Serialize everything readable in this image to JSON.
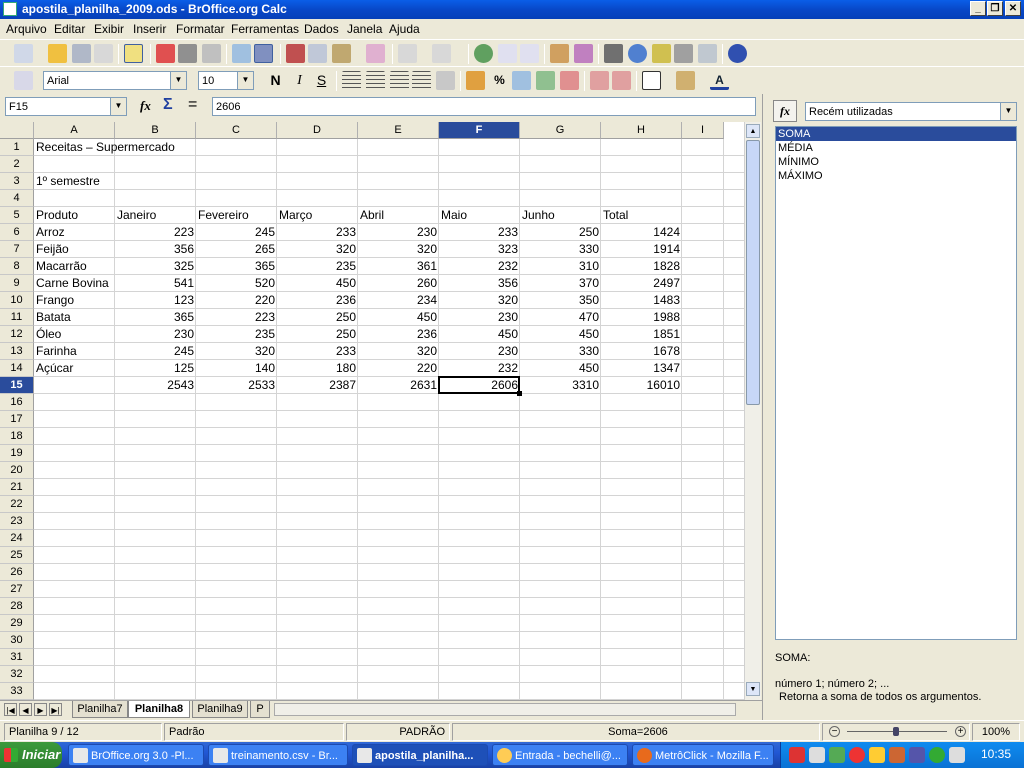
{
  "window": {
    "title": "apostila_planilha_2009.ods - BrOffice.org Calc",
    "minimize": "_",
    "maximize": "❐",
    "close": "✕"
  },
  "menu": [
    "Arquivo",
    "Editar",
    "Exibir",
    "Inserir",
    "Formatar",
    "Ferramentas",
    "Dados",
    "Janela",
    "Ajuda"
  ],
  "formatting": {
    "font_name": "Arial",
    "font_size": "10",
    "bold": "N",
    "italic": "I",
    "underline": "S"
  },
  "formula_bar": {
    "name_box": "F15",
    "function_wizard": "fx",
    "sum_symbol": "Σ",
    "equals": "=",
    "content": "2606"
  },
  "sheet": {
    "columns": [
      "A",
      "B",
      "C",
      "D",
      "E",
      "F",
      "G",
      "H",
      "I"
    ],
    "selected_column": "F",
    "selected_row": "15",
    "rows": [
      {
        "num": "1",
        "cells": [
          "Receitas – Supermercado",
          "",
          "",
          "",
          "",
          "",
          "",
          ""
        ]
      },
      {
        "num": "2",
        "cells": [
          "",
          "",
          "",
          "",
          "",
          "",
          "",
          ""
        ]
      },
      {
        "num": "3",
        "cells": [
          "1º semestre",
          "",
          "",
          "",
          "",
          "",
          "",
          ""
        ]
      },
      {
        "num": "4",
        "cells": [
          "",
          "",
          "",
          "",
          "",
          "",
          "",
          ""
        ]
      },
      {
        "num": "5",
        "cells": [
          "Produto",
          "Janeiro",
          "Fevereiro",
          "Março",
          "Abril",
          "Maio",
          "Junho",
          "Total"
        ]
      },
      {
        "num": "6",
        "cells": [
          "Arroz",
          "223",
          "245",
          "233",
          "230",
          "233",
          "250",
          "1424"
        ]
      },
      {
        "num": "7",
        "cells": [
          "Feijão",
          "356",
          "265",
          "320",
          "320",
          "323",
          "330",
          "1914"
        ]
      },
      {
        "num": "8",
        "cells": [
          "Macarrão",
          "325",
          "365",
          "235",
          "361",
          "232",
          "310",
          "1828"
        ]
      },
      {
        "num": "9",
        "cells": [
          "Carne Bovina",
          "541",
          "520",
          "450",
          "260",
          "356",
          "370",
          "2497"
        ]
      },
      {
        "num": "10",
        "cells": [
          "Frango",
          "123",
          "220",
          "236",
          "234",
          "320",
          "350",
          "1483"
        ]
      },
      {
        "num": "11",
        "cells": [
          "Batata",
          "365",
          "223",
          "250",
          "450",
          "230",
          "470",
          "1988"
        ]
      },
      {
        "num": "12",
        "cells": [
          "Óleo",
          "230",
          "235",
          "250",
          "236",
          "450",
          "450",
          "1851"
        ]
      },
      {
        "num": "13",
        "cells": [
          "Farinha",
          "245",
          "320",
          "233",
          "320",
          "230",
          "330",
          "1678"
        ]
      },
      {
        "num": "14",
        "cells": [
          "Açúcar",
          "125",
          "140",
          "180",
          "220",
          "232",
          "450",
          "1347"
        ]
      },
      {
        "num": "15",
        "cells": [
          "",
          "2543",
          "2533",
          "2387",
          "2631",
          "2606",
          "3310",
          "16010"
        ]
      },
      {
        "num": "16",
        "cells": []
      },
      {
        "num": "17",
        "cells": []
      },
      {
        "num": "18",
        "cells": []
      },
      {
        "num": "19",
        "cells": []
      },
      {
        "num": "20",
        "cells": []
      },
      {
        "num": "21",
        "cells": []
      },
      {
        "num": "22",
        "cells": []
      },
      {
        "num": "23",
        "cells": []
      },
      {
        "num": "24",
        "cells": []
      },
      {
        "num": "25",
        "cells": []
      },
      {
        "num": "26",
        "cells": []
      },
      {
        "num": "27",
        "cells": []
      },
      {
        "num": "28",
        "cells": []
      },
      {
        "num": "29",
        "cells": []
      },
      {
        "num": "30",
        "cells": []
      },
      {
        "num": "31",
        "cells": []
      },
      {
        "num": "32",
        "cells": []
      },
      {
        "num": "33",
        "cells": []
      }
    ]
  },
  "sheet_tabs": [
    {
      "label": "Planilha7",
      "active": false
    },
    {
      "label": "Planilha8",
      "active": true
    },
    {
      "label": "Planilha9",
      "active": false
    },
    {
      "label": "P",
      "active": false
    }
  ],
  "status": {
    "sheet_pos": "Planilha 9 / 12",
    "style": "Padrão",
    "mode": "PADRÃO",
    "sum": "Soma=2606",
    "zoom": "100%"
  },
  "function_panel": {
    "category": "Recém utilizadas",
    "functions": [
      "SOMA",
      "MÉDIA",
      "MÍNIMO",
      "MÁXIMO"
    ],
    "selected": "SOMA",
    "desc_name": "SOMA:",
    "desc_syntax": "número 1; número 2; ...",
    "desc_text": "Retorna a soma de todos os argumentos."
  },
  "taskbar": {
    "start": "Iniciar",
    "tasks": [
      "BrOffice.org 3.0 -Pl...",
      "treinamento.csv - Br...",
      "apostila_planilha...",
      "Entrada - bechelli@...",
      "MetrôClick - Mozilla F..."
    ],
    "active_task": 2,
    "clock": "10:35"
  },
  "colors": {
    "selection_header": "#2a4c9c",
    "titlebar": "#0a5ee8",
    "taskbar": "#2157d4",
    "start": "#2b7d2b"
  }
}
